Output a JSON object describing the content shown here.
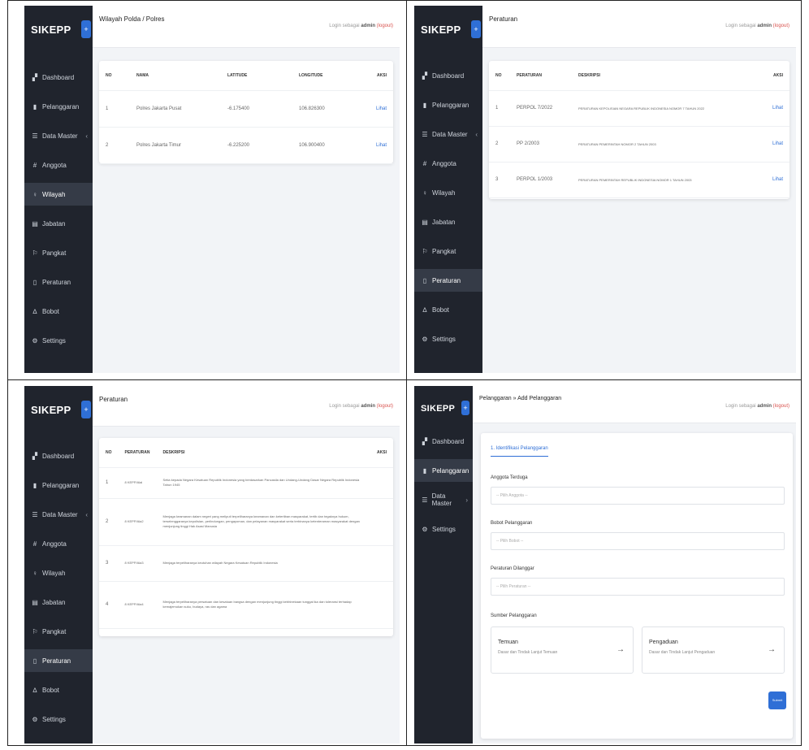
{
  "brand": "SIKEPP",
  "login": {
    "prefix": "Login sebagai",
    "user": "admin",
    "logout": "(logout)"
  },
  "sidebar_full": [
    {
      "icon": "▞",
      "label": "Dashboard"
    },
    {
      "icon": "▮",
      "label": "Pelanggaran"
    },
    {
      "icon": "☰",
      "label": "Data Master",
      "chev": "‹"
    },
    {
      "icon": "#",
      "label": "Anggota"
    },
    {
      "icon": "♀",
      "label": "Wilayah"
    },
    {
      "icon": "▤",
      "label": "Jabatan"
    },
    {
      "icon": "⚐",
      "label": "Pangkat"
    },
    {
      "icon": "▯",
      "label": "Peraturan"
    },
    {
      "icon": "∆",
      "label": "Bobot"
    },
    {
      "icon": "⚙",
      "label": "Settings"
    }
  ],
  "sidebar_short": [
    {
      "icon": "▞",
      "label": "Dashboard"
    },
    {
      "icon": "▮",
      "label": "Pelanggaran"
    },
    {
      "icon": "☰",
      "label": "Data Master",
      "chev": "›"
    },
    {
      "icon": "⚙",
      "label": "Settings"
    }
  ],
  "panel1": {
    "title": "Wilayah Polda / Polres",
    "headers": [
      "NO",
      "NAMA",
      "LATITUDE",
      "LONGITUDE",
      "AKSI"
    ],
    "rows": [
      [
        "1",
        "Polres Jakarta Pusat",
        "-6.175400",
        "106.826300",
        "Lihat"
      ],
      [
        "2",
        "Polres Jakarta Timur",
        "-6.225200",
        "106.900400",
        "Lihat"
      ]
    ]
  },
  "panel2": {
    "title": "Peraturan",
    "headers": [
      "NO",
      "PERATURAN",
      "DESKRIPSI",
      "AKSI"
    ],
    "rows": [
      [
        "1",
        "PERPOL 7/2022",
        "PERATURAN KEPOLISIAN NEGARA REPUBLIK INDONESIA NOMOR 7 TAHUN 2022",
        "Lihat"
      ],
      [
        "2",
        "PP 2/2003",
        "PERATURAN PEMERINTAH NOMOR 2 TAHUN 2003",
        "Lihat"
      ],
      [
        "3",
        "PERPOL 1/2003",
        "PERATURAN PEMERINTAH REPUBLIK INDONESIA NOMOR 1 TAHUN 2003",
        "Lihat"
      ]
    ]
  },
  "panel3": {
    "title": "Peraturan",
    "headers": [
      "NO",
      "PERATURAN",
      "DESKRIPSI",
      "AKSI"
    ],
    "rows": [
      [
        "1",
        "8 KEPP/Alal",
        "Setia kepada Negara Kesatuan Republik Indonesia yang berdasarkan Pancasila dan Undang-Undang Dasar Negara Republik Indonesia Tahun 1945"
      ],
      [
        "2",
        "8 KEPP/Ala2",
        "Menjaga keamanan dalam negeri yang meliputi terpeliharanya keamanan dan ketertiban masyarakat, tertib dan tegaknya hukum, terselenggaranya kepolisian, perlindungan, pengayoman, dan pelayanan masyarakat serta terbinanya ketenteraman masyarakat dengan menjunjung tinggi Hak Asasi Manusia"
      ],
      [
        "3",
        "8 KEPP/Ala3",
        "Menjaga terpeliharanya keutuhan wilayah Negara Kesatuan Republik Indonesia"
      ],
      [
        "4",
        "8 KEPP/Ala4",
        "Menjaga terpeliharanya persatuan dan kesatuan bangsa dengan menjunjung tinggi kebhinekaan tunggal ika dan toleransi terhadap kemajemukan suku, budaya, ras dan agama"
      ]
    ]
  },
  "panel4": {
    "title": "Pelanggaran » Add Pelanggaran",
    "tab": "1. Identifikasi Pelanggaran",
    "fields": [
      {
        "label": "Anggota Terduga",
        "placeholder": "-- Pilih Anggota --"
      },
      {
        "label": "Bobot Pelanggaran",
        "placeholder": "-- Pilih Bobot --"
      },
      {
        "label": "Peraturan Dilanggar",
        "placeholder": "-- Pilih Peraturan --"
      }
    ],
    "source_label": "Sumber Pelanggaran",
    "sources": [
      {
        "title": "Temuan",
        "desc": "Dasar dan Tindak Lanjut Temuan"
      },
      {
        "title": "Pengaduan",
        "desc": "Dasar dan Tindak Lanjut Pengaduan"
      }
    ],
    "submit": "Submit"
  }
}
